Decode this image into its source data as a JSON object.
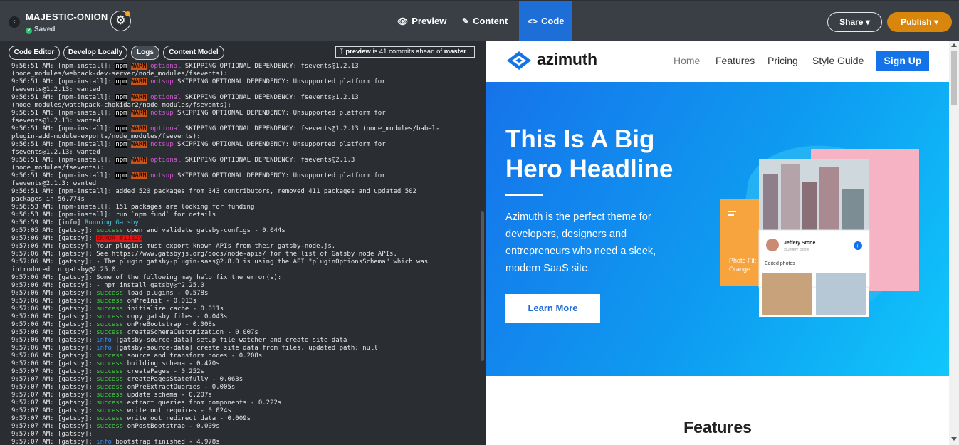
{
  "topbar": {
    "site_name": "MAJESTIC-ONION",
    "status": "Saved",
    "tabs": [
      {
        "label": "Preview",
        "icon": "eye-icon"
      },
      {
        "label": "Content",
        "icon": "pencil-icon"
      },
      {
        "label": "Code",
        "icon": "code-icon"
      }
    ],
    "share_label": "Share",
    "publish_label": "Publish"
  },
  "code_panel": {
    "tabs": [
      "Code Editor",
      "Develop Locally",
      "Logs",
      "Content Model"
    ],
    "active_tab": "Logs",
    "commits": {
      "branch": "preview",
      "text": "is 41 commits ahead of",
      "target": "master"
    },
    "log_lines": [
      {
        "time": "9:56:51 AM:",
        "src": "[npm-install]:",
        "tags": [
          "npm",
          "WARN",
          "optional"
        ],
        "msg": "SKIPPING OPTIONAL DEPENDENCY: fsevents@1.2.13"
      },
      {
        "time": "",
        "src": "",
        "tags": [],
        "msg": "(node_modules/webpack-dev-server/node_modules/fsevents):"
      },
      {
        "time": "9:56:51 AM:",
        "src": "[npm-install]:",
        "tags": [
          "npm",
          "WARN",
          "notsup"
        ],
        "msg": "SKIPPING OPTIONAL DEPENDENCY: Unsupported platform for"
      },
      {
        "time": "",
        "src": "",
        "tags": [],
        "msg": "fsevents@1.2.13: wanted"
      },
      {
        "time": "9:56:51 AM:",
        "src": "[npm-install]:",
        "tags": [
          "npm",
          "WARN",
          "optional"
        ],
        "msg": "SKIPPING OPTIONAL DEPENDENCY: fsevents@1.2.13"
      },
      {
        "time": "",
        "src": "",
        "tags": [],
        "msg": "(node_modules/watchpack-chokidar2/node_modules/fsevents):"
      },
      {
        "time": "9:56:51 AM:",
        "src": "[npm-install]:",
        "tags": [
          "npm",
          "WARN",
          "notsup"
        ],
        "msg": "SKIPPING OPTIONAL DEPENDENCY: Unsupported platform for"
      },
      {
        "time": "",
        "src": "",
        "tags": [],
        "msg": "fsevents@1.2.13: wanted"
      },
      {
        "time": "9:56:51 AM:",
        "src": "[npm-install]:",
        "tags": [
          "npm",
          "WARN",
          "optional"
        ],
        "msg": "SKIPPING OPTIONAL DEPENDENCY: fsevents@1.2.13 (node_modules/babel-"
      },
      {
        "time": "",
        "src": "",
        "tags": [],
        "msg": "plugin-add-module-exports/node_modules/fsevents):"
      },
      {
        "time": "9:56:51 AM:",
        "src": "[npm-install]:",
        "tags": [
          "npm",
          "WARN",
          "notsup"
        ],
        "msg": "SKIPPING OPTIONAL DEPENDENCY: Unsupported platform for"
      },
      {
        "time": "",
        "src": "",
        "tags": [],
        "msg": "fsevents@1.2.13: wanted"
      },
      {
        "time": "9:56:51 AM:",
        "src": "[npm-install]:",
        "tags": [
          "npm",
          "WARN",
          "optional"
        ],
        "msg": "SKIPPING OPTIONAL DEPENDENCY: fsevents@2.1.3"
      },
      {
        "time": "",
        "src": "",
        "tags": [],
        "msg": "(node_modules/fsevents):"
      },
      {
        "time": "9:56:51 AM:",
        "src": "[npm-install]:",
        "tags": [
          "npm",
          "WARN",
          "notsup"
        ],
        "msg": "SKIPPING OPTIONAL DEPENDENCY: Unsupported platform for"
      },
      {
        "time": "",
        "src": "",
        "tags": [],
        "msg": "fsevents@2.1.3: wanted"
      },
      {
        "time": "9:56:51 AM:",
        "src": "[npm-install]:",
        "tags": [],
        "msg": "added 520 packages from 343 contributors, removed 411 packages and updated 502"
      },
      {
        "time": "",
        "src": "",
        "tags": [],
        "msg": "packages in 56.774s"
      },
      {
        "time": "9:56:53 AM:",
        "src": "[npm-install]:",
        "tags": [],
        "msg": "151 packages are looking for funding"
      },
      {
        "time": "9:56:53 AM:",
        "src": "[npm-install]:",
        "tags": [],
        "msg": "run `npm fund` for details"
      },
      {
        "time": "9:56:59 AM:",
        "src": "[info]",
        "tags": [
          "Running Gatsby"
        ],
        "msg": ""
      },
      {
        "time": "9:57:05 AM:",
        "src": "[gatsby]:",
        "tags": [
          "success"
        ],
        "msg": "open and validate gatsby-configs - 0.044s"
      },
      {
        "time": "9:57:06 AM:",
        "src": "[gatsby]:",
        "tags": [
          "ERROR #11329"
        ],
        "msg": ""
      },
      {
        "time": "9:57:06 AM:",
        "src": "[gatsby]:",
        "tags": [],
        "msg": "Your plugins must export known APIs from their gatsby-node.js."
      },
      {
        "time": "9:57:06 AM:",
        "src": "[gatsby]:",
        "tags": [],
        "msg": "See https://www.gatsbyjs.org/docs/node-apis/ for the list of Gatsby node APIs."
      },
      {
        "time": "9:57:06 AM:",
        "src": "[gatsby]:",
        "tags": [],
        "msg": "- The plugin gatsby-plugin-sass@2.8.0 is using the API \"pluginOptionsSchema\" which was"
      },
      {
        "time": "",
        "src": "",
        "tags": [],
        "msg": "introduced in gatsby@2.25.0."
      },
      {
        "time": "9:57:06 AM:",
        "src": "[gatsby]:",
        "tags": [],
        "msg": "Some of the following may help fix the error(s):"
      },
      {
        "time": "9:57:06 AM:",
        "src": "[gatsby]:",
        "tags": [],
        "msg": "- npm install gatsby@^2.25.0"
      },
      {
        "time": "9:57:06 AM:",
        "src": "[gatsby]:",
        "tags": [
          "success"
        ],
        "msg": "load plugins - 0.578s"
      },
      {
        "time": "9:57:06 AM:",
        "src": "[gatsby]:",
        "tags": [
          "success"
        ],
        "msg": "onPreInit - 0.013s"
      },
      {
        "time": "9:57:06 AM:",
        "src": "[gatsby]:",
        "tags": [
          "success"
        ],
        "msg": "initialize cache - 0.011s"
      },
      {
        "time": "9:57:06 AM:",
        "src": "[gatsby]:",
        "tags": [
          "success"
        ],
        "msg": "copy gatsby files - 0.043s"
      },
      {
        "time": "9:57:06 AM:",
        "src": "[gatsby]:",
        "tags": [
          "success"
        ],
        "msg": "onPreBootstrap - 0.008s"
      },
      {
        "time": "9:57:06 AM:",
        "src": "[gatsby]:",
        "tags": [
          "success"
        ],
        "msg": "createSchemaCustomization - 0.007s"
      },
      {
        "time": "9:57:06 AM:",
        "src": "[gatsby]:",
        "tags": [
          "info"
        ],
        "msg": "[gatsby-source-data] setup file watcher and create site data"
      },
      {
        "time": "9:57:06 AM:",
        "src": "[gatsby]:",
        "tags": [
          "info"
        ],
        "msg": "[gatsby-source-data] create site data from files, updated path: null"
      },
      {
        "time": "9:57:06 AM:",
        "src": "[gatsby]:",
        "tags": [
          "success"
        ],
        "msg": "source and transform nodes - 0.208s"
      },
      {
        "time": "9:57:06 AM:",
        "src": "[gatsby]:",
        "tags": [
          "success"
        ],
        "msg": "building schema - 0.470s"
      },
      {
        "time": "9:57:07 AM:",
        "src": "[gatsby]:",
        "tags": [
          "success"
        ],
        "msg": "createPages - 0.252s"
      },
      {
        "time": "9:57:07 AM:",
        "src": "[gatsby]:",
        "tags": [
          "success"
        ],
        "msg": "createPagesStatefully - 0.063s"
      },
      {
        "time": "9:57:07 AM:",
        "src": "[gatsby]:",
        "tags": [
          "success"
        ],
        "msg": "onPreExtractQueries - 0.005s"
      },
      {
        "time": "9:57:07 AM:",
        "src": "[gatsby]:",
        "tags": [
          "success"
        ],
        "msg": "update schema - 0.207s"
      },
      {
        "time": "9:57:07 AM:",
        "src": "[gatsby]:",
        "tags": [
          "success"
        ],
        "msg": "extract queries from components - 0.222s"
      },
      {
        "time": "9:57:07 AM:",
        "src": "[gatsby]:",
        "tags": [
          "success"
        ],
        "msg": "write out requires - 0.024s"
      },
      {
        "time": "9:57:07 AM:",
        "src": "[gatsby]:",
        "tags": [
          "success"
        ],
        "msg": "write out redirect data - 0.009s"
      },
      {
        "time": "9:57:07 AM:",
        "src": "[gatsby]:",
        "tags": [
          "success"
        ],
        "msg": "onPostBootstrap - 0.009s"
      },
      {
        "time": "9:57:07 AM:",
        "src": "[gatsby]:",
        "tags": [],
        "msg": ""
      },
      {
        "time": "9:57:07 AM:",
        "src": "[gatsby]:",
        "tags": [
          "info"
        ],
        "msg": "bootstrap finished - 4.978s"
      }
    ]
  },
  "preview": {
    "logo_text": "azimuth",
    "nav": [
      "Home",
      "Features",
      "Pricing",
      "Style Guide"
    ],
    "signup_label": "Sign Up",
    "hero": {
      "title": "This Is A Big Hero Headline",
      "text": "Azimuth is the perfect theme for developers, designers and entrepreneurs who need a sleek, modern SaaS site.",
      "button": "Learn More",
      "art_labels": {
        "card_name": "Jeffery Stone",
        "card_handle": "@Jeffery_Stone",
        "card_section": "Edited photos",
        "side_label_1": "Photo Filt",
        "side_label_2": "Orange"
      }
    },
    "features_title": "Features"
  },
  "colors": {
    "topbar_bg": "#3a3f46",
    "active_tab": "#1e6ed8",
    "publish": "#d9860c",
    "brand_blue": "#1573e9",
    "warn": "#c8561c",
    "success": "#3ed13e",
    "error": "#e01515"
  }
}
